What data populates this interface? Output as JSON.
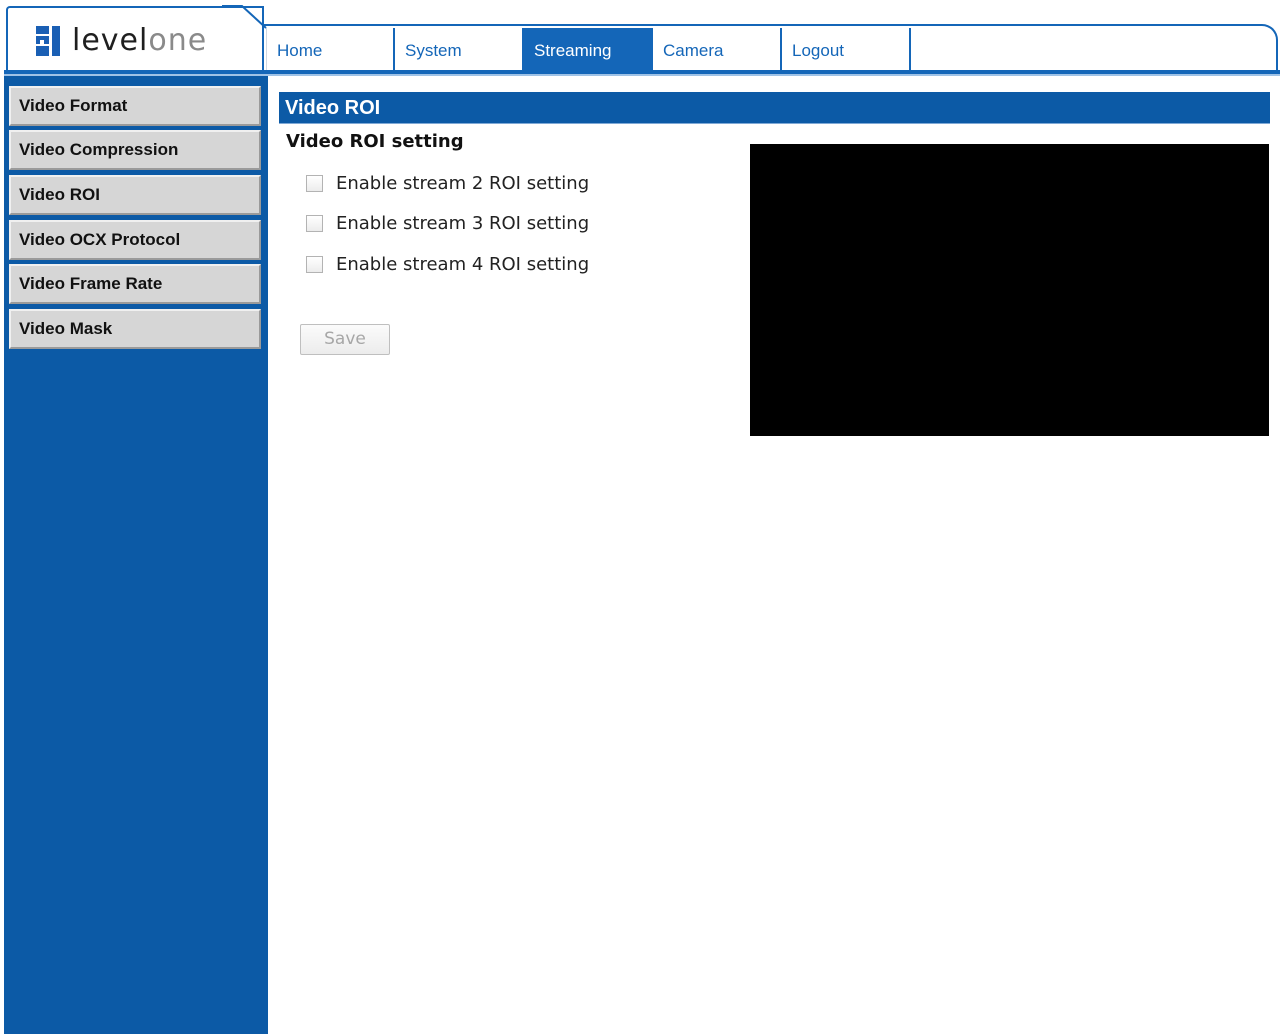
{
  "brand": {
    "logo_text_dark": "level",
    "logo_text_light": "one"
  },
  "nav": {
    "tabs": [
      {
        "label": "Home",
        "active": false
      },
      {
        "label": "System",
        "active": false
      },
      {
        "label": "Streaming",
        "active": true
      },
      {
        "label": "Camera",
        "active": false
      },
      {
        "label": "Logout",
        "active": false
      }
    ]
  },
  "sidebar": {
    "items": [
      {
        "label": "Video Format"
      },
      {
        "label": "Video Compression"
      },
      {
        "label": "Video ROI"
      },
      {
        "label": "Video OCX Protocol"
      },
      {
        "label": "Video Frame Rate"
      },
      {
        "label": "Video Mask"
      }
    ]
  },
  "main": {
    "title": "Video ROI",
    "section_title": "Video ROI setting",
    "checkboxes": [
      {
        "label": "Enable stream 2 ROI setting",
        "checked": false
      },
      {
        "label": "Enable stream 3 ROI setting",
        "checked": false
      },
      {
        "label": "Enable stream 4 ROI setting",
        "checked": false
      }
    ],
    "save_label": "Save"
  },
  "colors": {
    "brand_blue": "#1466b8",
    "sidebar_blue": "#0c5aa6",
    "sidebar_item_gray": "#d6d6d6",
    "preview_black": "#000000"
  }
}
